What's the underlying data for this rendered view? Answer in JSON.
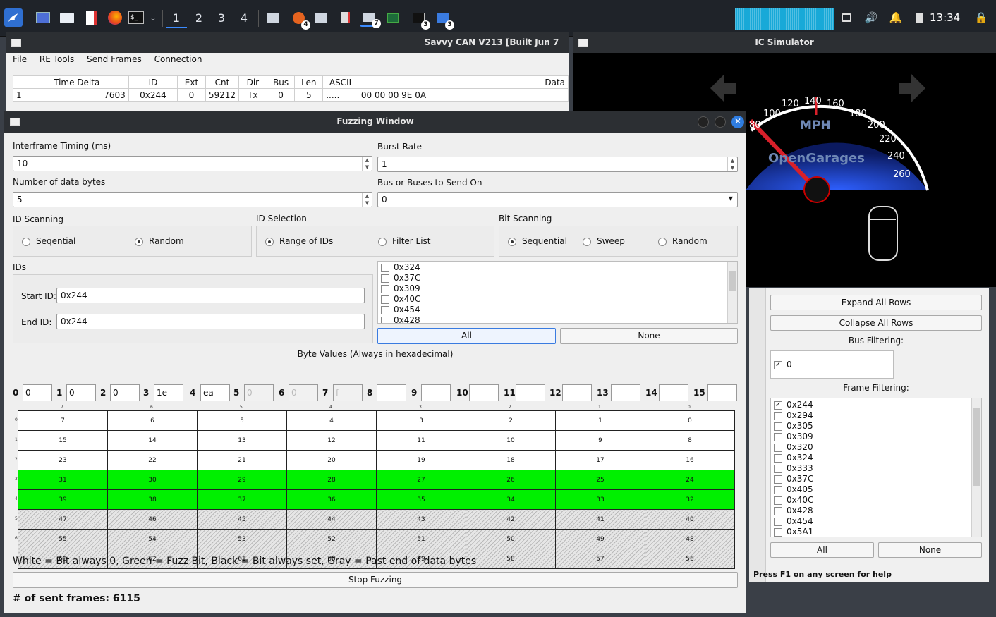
{
  "taskbar": {
    "workspaces": [
      "1",
      "2",
      "3",
      "4"
    ],
    "active_workspace": "1",
    "badges": [
      "4",
      "7",
      "3",
      "3"
    ],
    "clock": "13:34",
    "icons": [
      "kali-dragon-icon",
      "terminal-window-icon",
      "folder-icon",
      "editor-icon",
      "firefox-icon",
      "terminal-icon",
      "chevron-down-icon"
    ]
  },
  "savvy": {
    "title": "Savvy CAN V213 [Built Jun  7 2024]",
    "menu": [
      "File",
      "RE Tools",
      "Send Frames",
      "Connection"
    ],
    "columns": [
      "Time Delta",
      "ID",
      "Ext",
      "Cnt",
      "Dir",
      "Bus",
      "Len",
      "ASCII",
      "Data"
    ],
    "rows": [
      {
        "n": "1",
        "time_delta": "7603",
        "id": "0x244",
        "ext": "0",
        "cnt": "59212",
        "dir": "Tx",
        "bus": "0",
        "len": "5",
        "ascii": ".....",
        "data": "00 00 00 9E 0A"
      }
    ]
  },
  "icsim": {
    "title": "IC Simulator",
    "unit": "MPH",
    "brand": "OpenGarages",
    "ticks": [
      "80",
      "100",
      "120",
      "140",
      "160",
      "180",
      "200",
      "220",
      "240",
      "260"
    ]
  },
  "fuzz": {
    "title": "Fuzzing Window",
    "interframe_label": "Interframe Timing (ms)",
    "interframe_value": "10",
    "burst_label": "Burst Rate",
    "burst_value": "1",
    "databytes_label": "Number of data bytes",
    "databytes_value": "5",
    "bus_label": "Bus or Buses to Send On",
    "bus_value": "0",
    "id_scanning": {
      "label": "ID Scanning",
      "options": [
        "Seqential",
        "Random"
      ],
      "selected": "Random"
    },
    "id_selection": {
      "label": "ID Selection",
      "options": [
        "Range of IDs",
        "Filter List"
      ],
      "selected": "Range of IDs"
    },
    "bit_scanning": {
      "label": "Bit Scanning",
      "options": [
        "Sequential",
        "Sweep",
        "Random"
      ],
      "selected": "Sequential"
    },
    "ids_label": "IDs",
    "start_label": "Start ID:",
    "start_value": "0x244",
    "end_label": "End ID:",
    "end_value": "0x244",
    "id_list": [
      "0x324",
      "0x37C",
      "0x309",
      "0x40C",
      "0x454",
      "0x428"
    ],
    "all_label": "All",
    "none_label": "None",
    "byte_values_label": "Byte Values (Always in hexadecimal)",
    "bytes": [
      {
        "i": "0",
        "v": "0"
      },
      {
        "i": "1",
        "v": "0"
      },
      {
        "i": "2",
        "v": "0"
      },
      {
        "i": "3",
        "v": "1e"
      },
      {
        "i": "4",
        "v": "ea"
      },
      {
        "i": "5",
        "v": "0"
      },
      {
        "i": "6",
        "v": "0"
      },
      {
        "i": "7",
        "v": "f"
      },
      {
        "i": "8",
        "v": ""
      },
      {
        "i": "9",
        "v": ""
      },
      {
        "i": "10",
        "v": ""
      },
      {
        "i": "11",
        "v": ""
      },
      {
        "i": "12",
        "v": ""
      },
      {
        "i": "13",
        "v": ""
      },
      {
        "i": "14",
        "v": ""
      },
      {
        "i": "15",
        "v": ""
      }
    ],
    "bit_headers": [
      "7",
      "6",
      "5",
      "4",
      "3",
      "2",
      "1",
      "0"
    ],
    "bit_rows": [
      {
        "row": "0",
        "state": "white",
        "cells": [
          "7",
          "6",
          "5",
          "4",
          "3",
          "2",
          "1",
          "0"
        ]
      },
      {
        "row": "1",
        "state": "white",
        "cells": [
          "15",
          "14",
          "13",
          "12",
          "11",
          "10",
          "9",
          "8"
        ]
      },
      {
        "row": "2",
        "state": "white",
        "cells": [
          "23",
          "22",
          "21",
          "20",
          "19",
          "18",
          "17",
          "16"
        ]
      },
      {
        "row": "3",
        "state": "fuzz",
        "cells": [
          "31",
          "30",
          "29",
          "28",
          "27",
          "26",
          "25",
          "24"
        ]
      },
      {
        "row": "4",
        "state": "fuzz",
        "cells": [
          "39",
          "38",
          "37",
          "36",
          "35",
          "34",
          "33",
          "32"
        ]
      },
      {
        "row": "5",
        "state": "past",
        "cells": [
          "47",
          "46",
          "45",
          "44",
          "43",
          "42",
          "41",
          "40"
        ]
      },
      {
        "row": "6",
        "state": "past",
        "cells": [
          "55",
          "54",
          "53",
          "52",
          "51",
          "50",
          "49",
          "48"
        ]
      },
      {
        "row": "7",
        "state": "past",
        "cells": [
          "63",
          "62",
          "61",
          "60",
          "59",
          "58",
          "57",
          "56"
        ]
      }
    ],
    "legend": "White = Bit always 0, Green = Fuzz Bit, Black = Bit always set, Gray = Past end of data bytes",
    "stop_label": "Stop Fuzzing",
    "sent_frames": "# of sent frames: 6115"
  },
  "rpanel": {
    "expand_label": "Expand All Rows",
    "collapse_label": "Collapse All Rows",
    "bus_filter_label": "Bus Filtering:",
    "bus_item": "0",
    "frame_filter_label": "Frame Filtering:",
    "frames": [
      {
        "id": "0x244",
        "checked": true
      },
      {
        "id": "0x294",
        "checked": false
      },
      {
        "id": "0x305",
        "checked": false
      },
      {
        "id": "0x309",
        "checked": false
      },
      {
        "id": "0x320",
        "checked": false
      },
      {
        "id": "0x324",
        "checked": false
      },
      {
        "id": "0x333",
        "checked": false
      },
      {
        "id": "0x37C",
        "checked": false
      },
      {
        "id": "0x405",
        "checked": false
      },
      {
        "id": "0x40C",
        "checked": false
      },
      {
        "id": "0x428",
        "checked": false
      },
      {
        "id": "0x454",
        "checked": false
      },
      {
        "id": "0x5A1",
        "checked": false
      }
    ],
    "all_label": "All",
    "none_label": "None",
    "help_text": "Press F1 on any screen for help"
  }
}
